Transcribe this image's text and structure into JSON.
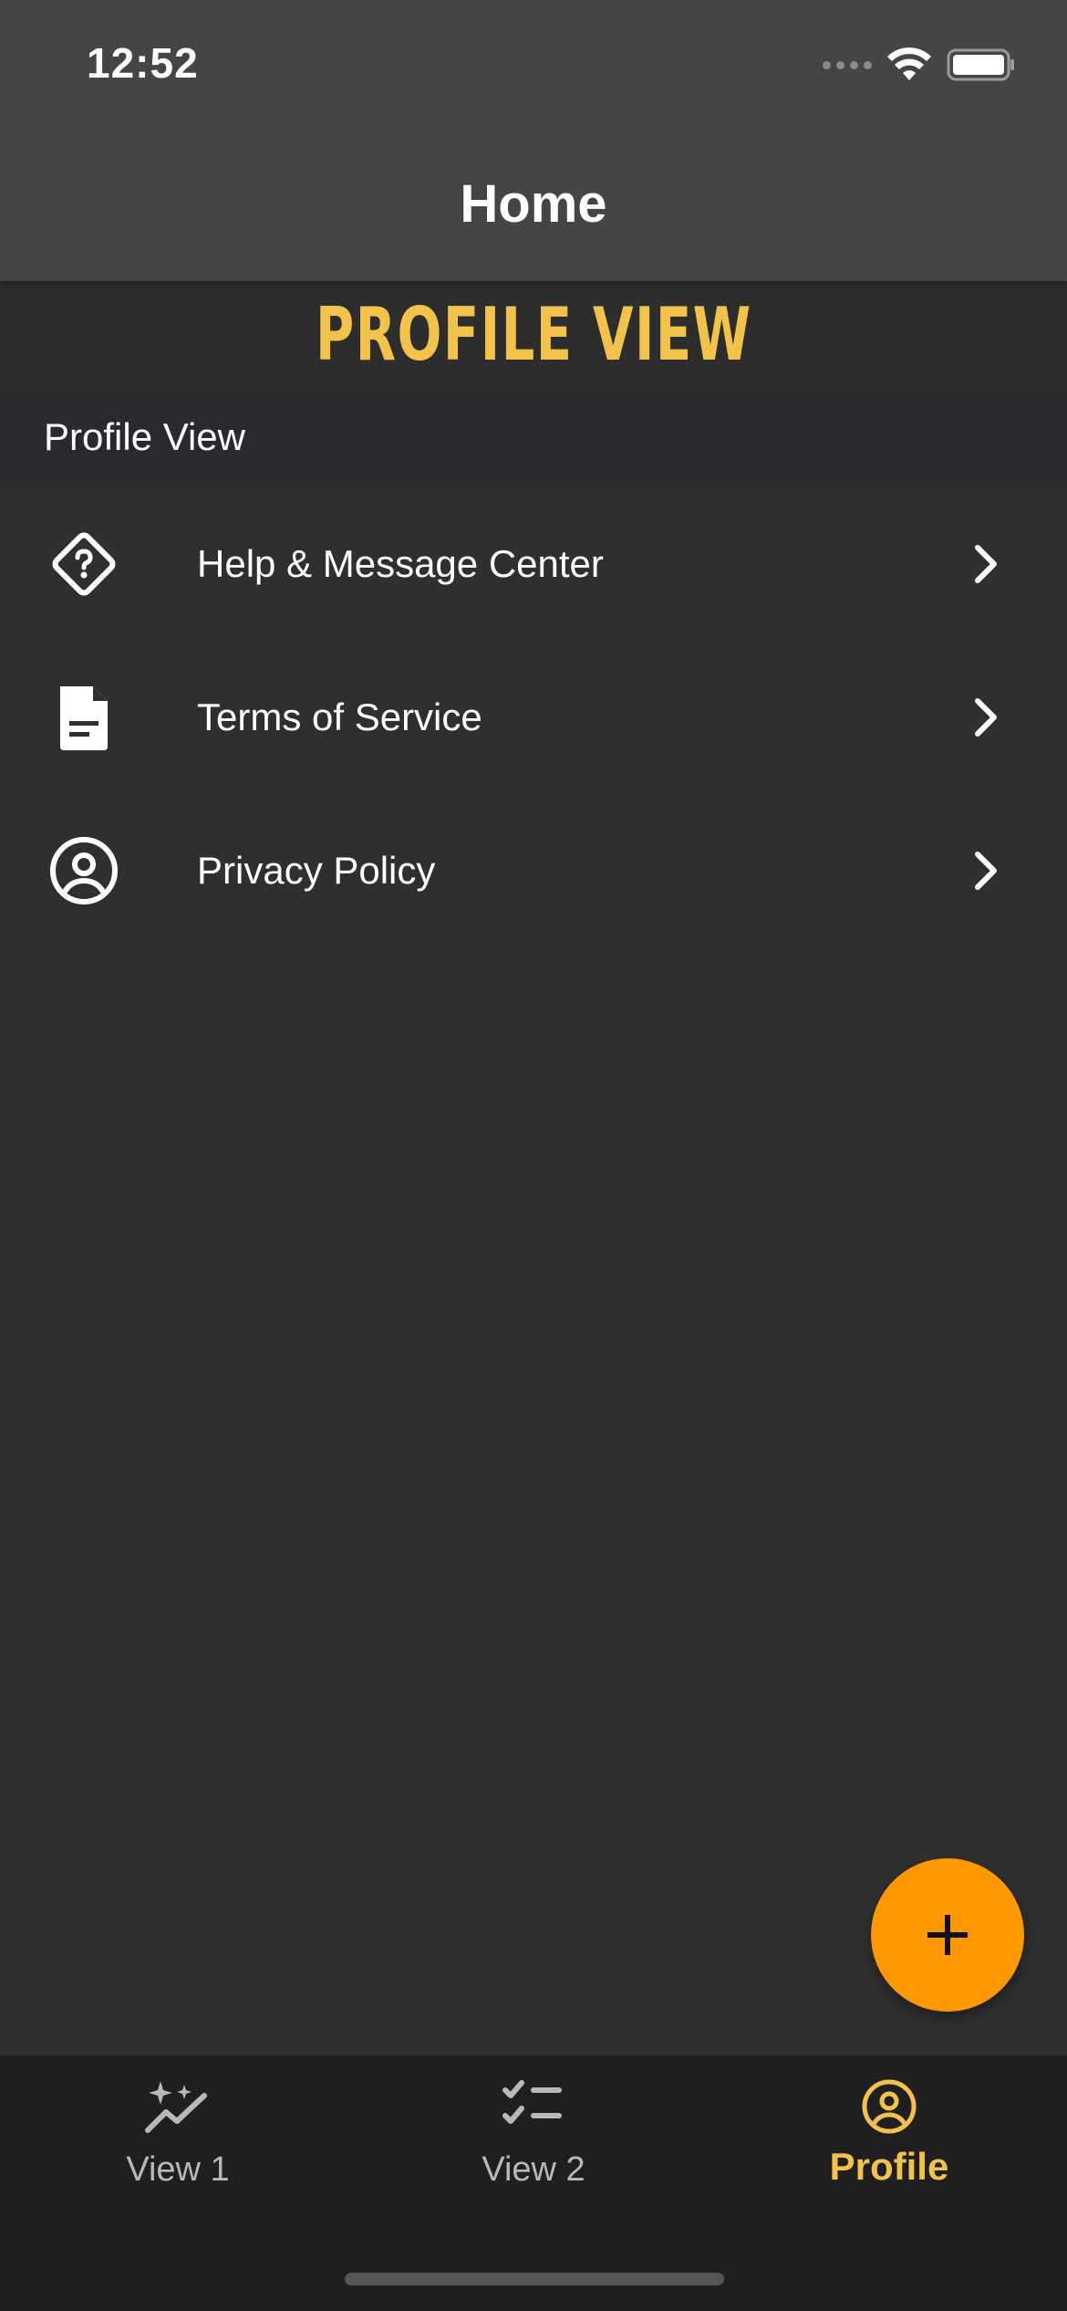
{
  "status_bar": {
    "time": "12:52"
  },
  "header": {
    "title": "Home"
  },
  "banner": {
    "title": "PROFILE VIEW"
  },
  "section": {
    "title": "Profile View"
  },
  "menu": {
    "items": [
      {
        "label": "Help & Message Center",
        "icon": "help-diamond-icon"
      },
      {
        "label": "Terms of Service",
        "icon": "document-icon"
      },
      {
        "label": "Privacy Policy",
        "icon": "user-circle-icon"
      }
    ]
  },
  "fab": {
    "icon": "plus-icon"
  },
  "tabs": [
    {
      "label": "View 1",
      "icon": "sparkle-chart-icon",
      "active": false
    },
    {
      "label": "View 2",
      "icon": "checklist-icon",
      "active": false
    },
    {
      "label": "Profile",
      "icon": "user-circle-icon",
      "active": true
    }
  ],
  "colors": {
    "accent": "#f3c24a",
    "fab": "#ff9800",
    "header_bg": "#454545",
    "body_bg": "#2f2f2f",
    "tabbar_bg": "#1f1f1f"
  }
}
